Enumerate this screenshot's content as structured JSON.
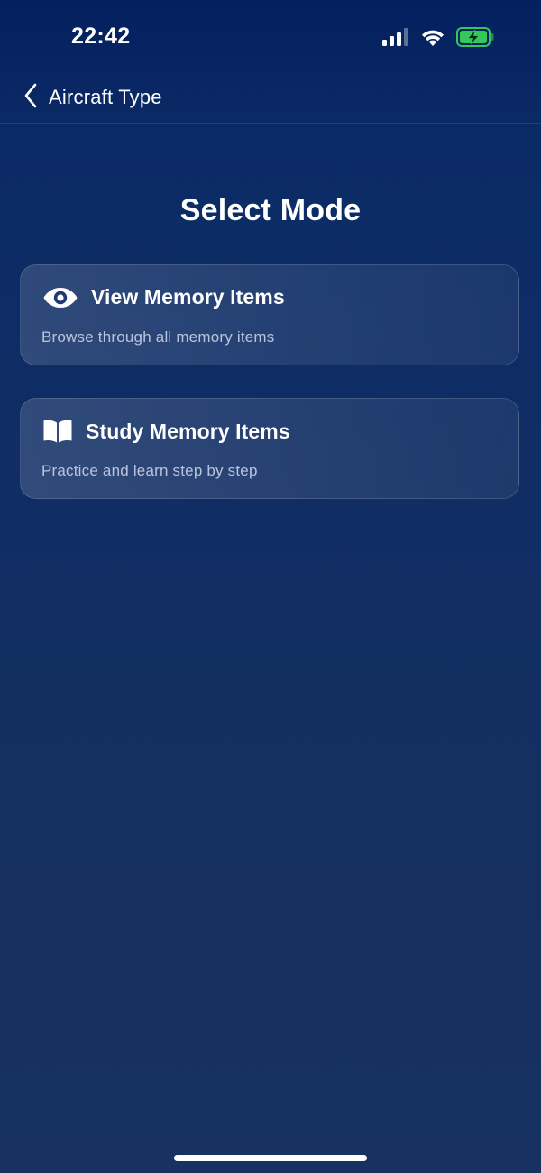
{
  "status_bar": {
    "time": "22:42",
    "icons": [
      "cellular-signal-icon",
      "wifi-icon",
      "battery-charging-icon"
    ],
    "battery_color": "#34c759"
  },
  "nav": {
    "back_label": "Aircraft Type",
    "back_icon": "chevron-left-icon"
  },
  "page": {
    "title": "Select Mode"
  },
  "modes": [
    {
      "icon": "eye-icon",
      "title": "View Memory Items",
      "subtitle": "Browse through all memory items"
    },
    {
      "icon": "book-icon",
      "title": "Study Memory Items",
      "subtitle": "Practice and learn step by step"
    }
  ],
  "colors": {
    "background_top": "#04205f",
    "background_bottom": "#173260",
    "text": "#ffffff"
  }
}
